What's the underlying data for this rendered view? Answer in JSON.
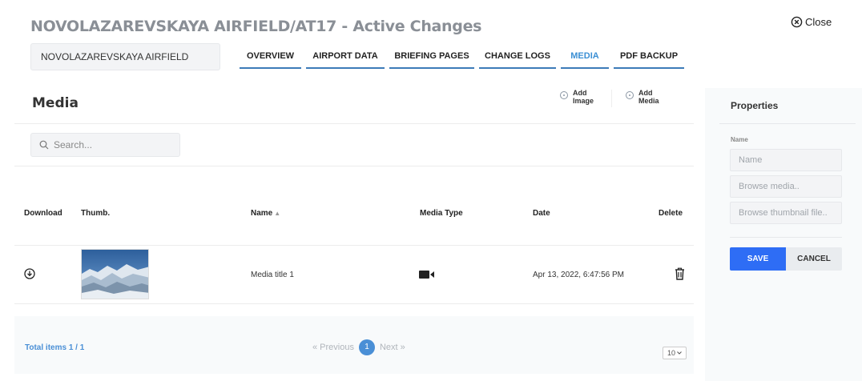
{
  "header": {
    "title": "NOVOLAZAREVSKAYA AIRFIELD/AT17 - Active Changes",
    "close_label": "Close",
    "airport_name": "NOVOLAZAREVSKAYA AIRFIELD"
  },
  "tabs": [
    {
      "label": "OVERVIEW",
      "active": false
    },
    {
      "label": "AIRPORT DATA",
      "active": false
    },
    {
      "label": "BRIEFING PAGES",
      "active": false
    },
    {
      "label": "CHANGE LOGS",
      "active": false
    },
    {
      "label": "MEDIA",
      "active": true
    },
    {
      "label": "PDF BACKUP",
      "active": false
    }
  ],
  "media": {
    "title": "Media",
    "add_image_label_1": "Add",
    "add_image_label_2": "Image",
    "add_media_label_1": "Add",
    "add_media_label_2": "Media",
    "search_placeholder": "Search...",
    "columns": {
      "download": "Download",
      "thumb": "Thumb.",
      "name": "Name",
      "media_type": "Media Type",
      "date": "Date",
      "delete": "Delete"
    },
    "rows": [
      {
        "name": "Media title 1",
        "media_type_icon": "video-camera-icon",
        "date": "Apr 13, 2022, 6:47:56 PM"
      }
    ],
    "total_items": "Total items 1 / 1",
    "pagination": {
      "previous": "« Previous",
      "current_page": "1",
      "next": "Next »"
    },
    "page_size": "10"
  },
  "properties": {
    "title": "Properties",
    "name_label": "Name",
    "name_placeholder": "Name",
    "browse_media_placeholder": "Browse media..",
    "browse_thumbnail_placeholder": "Browse thumbnail file..",
    "save_label": "SAVE",
    "cancel_label": "CANCEL"
  },
  "colors": {
    "accent": "#2e6df5",
    "link": "#4a8fd6",
    "tab_underline": "#3d7bb8"
  }
}
